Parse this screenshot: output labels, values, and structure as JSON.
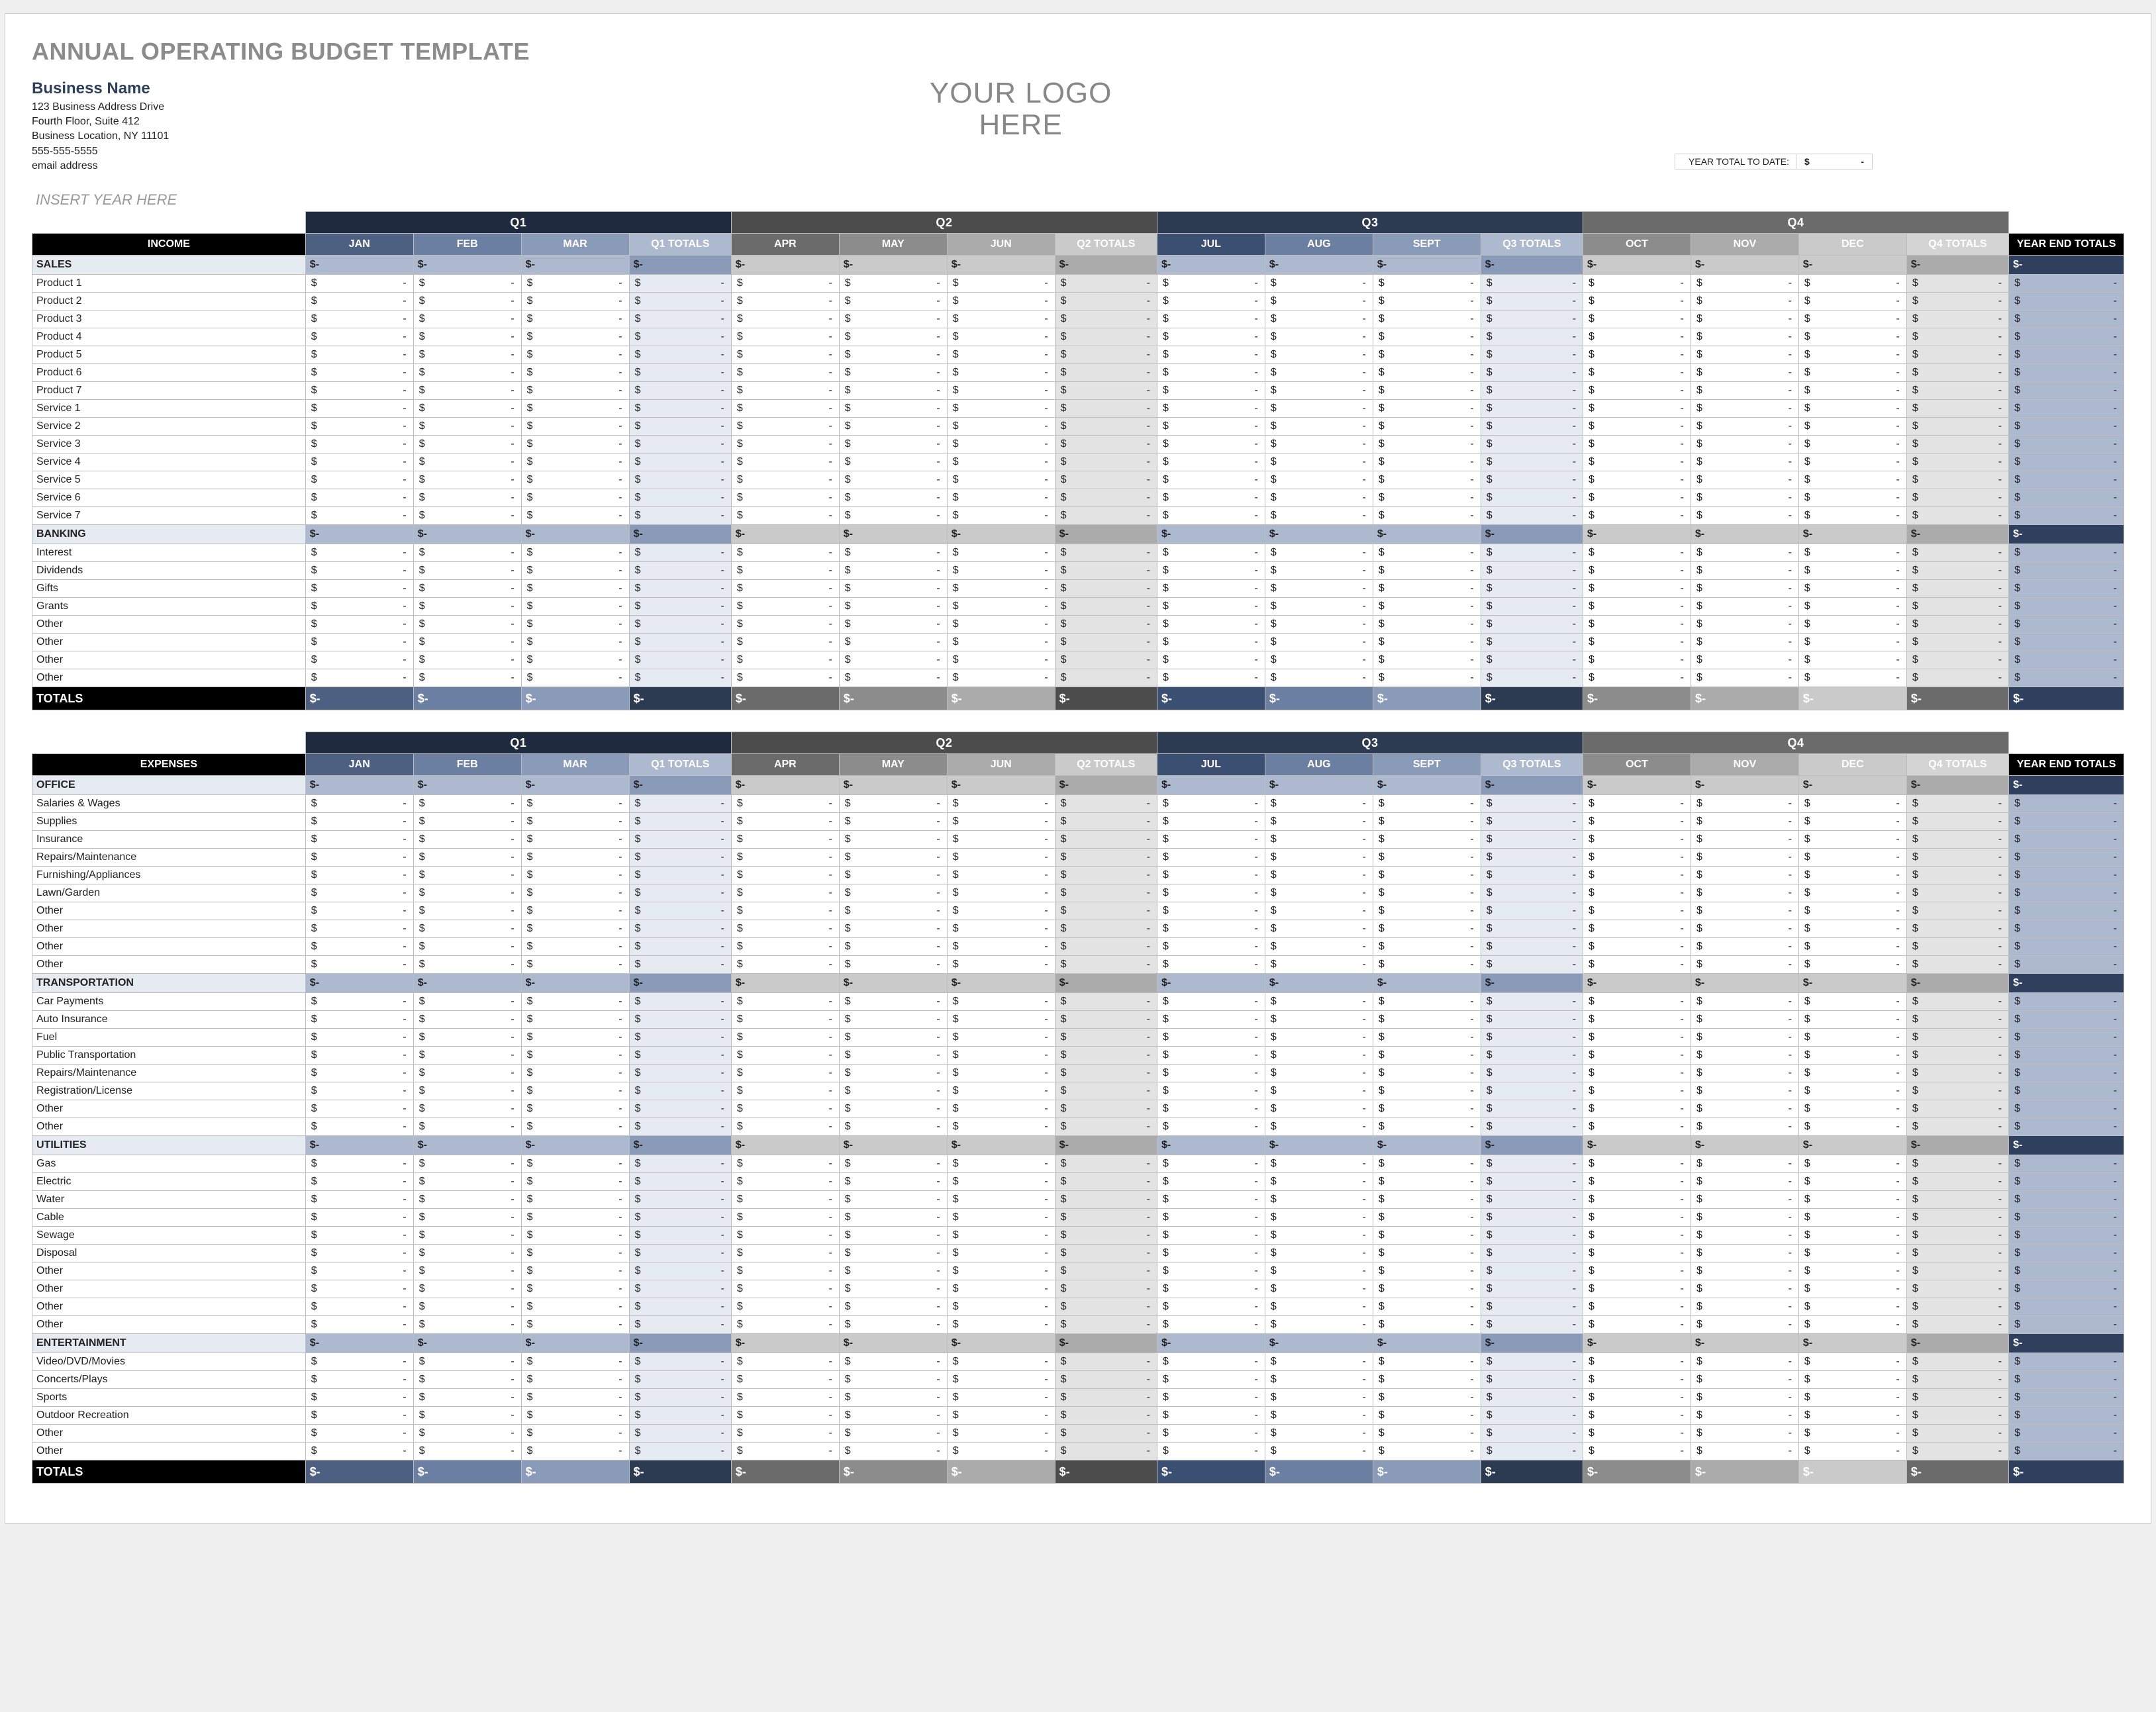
{
  "title": "ANNUAL OPERATING BUDGET TEMPLATE",
  "business": {
    "name": "Business Name",
    "addr1": "123 Business Address Drive",
    "addr2": "Fourth Floor, Suite 412",
    "addr3": "Business Location, NY  11101",
    "phone": "555-555-5555",
    "email": "email address"
  },
  "logo_line1": "YOUR LOGO",
  "logo_line2": "HERE",
  "year_total_label": "YEAR TOTAL TO DATE:",
  "year_total_currency": "$",
  "year_total_value": "-",
  "year_placeholder": "INSERT YEAR HERE",
  "quarters": [
    "Q1",
    "Q2",
    "Q3",
    "Q4"
  ],
  "months": [
    "JAN",
    "FEB",
    "MAR",
    "APR",
    "MAY",
    "JUN",
    "JUL",
    "AUG",
    "SEPT",
    "OCT",
    "NOV",
    "DEC"
  ],
  "q_totals": [
    "Q1 TOTALS",
    "Q2 TOTALS",
    "Q3 TOTALS",
    "Q4 TOTALS"
  ],
  "year_end": "YEAR END TOTALS",
  "blocks": [
    {
      "header": "INCOME",
      "totals_label": "TOTALS",
      "sections": [
        {
          "name": "SALES",
          "rows": [
            "Product 1",
            "Product 2",
            "Product 3",
            "Product 4",
            "Product 5",
            "Product 6",
            "Product 7",
            "Service 1",
            "Service 2",
            "Service 3",
            "Service 4",
            "Service 5",
            "Service 6",
            "Service 7"
          ]
        },
        {
          "name": "BANKING",
          "rows": [
            "Interest",
            "Dividends",
            "Gifts",
            "Grants",
            "Other",
            "Other",
            "Other",
            "Other"
          ]
        }
      ]
    },
    {
      "header": "EXPENSES",
      "totals_label": "TOTALS",
      "sections": [
        {
          "name": "OFFICE",
          "rows": [
            "Salaries & Wages",
            "Supplies",
            "Insurance",
            "Repairs/Maintenance",
            "Furnishing/Appliances",
            "Lawn/Garden",
            "Other",
            "Other",
            "Other",
            "Other"
          ]
        },
        {
          "name": "TRANSPORTATION",
          "rows": [
            "Car Payments",
            "Auto Insurance",
            "Fuel",
            "Public Transportation",
            "Repairs/Maintenance",
            "Registration/License",
            "Other",
            "Other"
          ]
        },
        {
          "name": "UTILITIES",
          "rows": [
            "Gas",
            "Electric",
            "Water",
            "Cable",
            "Sewage",
            "Disposal",
            "Other",
            "Other",
            "Other",
            "Other"
          ]
        },
        {
          "name": "ENTERTAINMENT",
          "rows": [
            "Video/DVD/Movies",
            "Concerts/Plays",
            "Sports",
            "Outdoor Recreation",
            "Other",
            "Other"
          ]
        }
      ]
    }
  ],
  "cell_currency": "$",
  "cell_value": "-"
}
